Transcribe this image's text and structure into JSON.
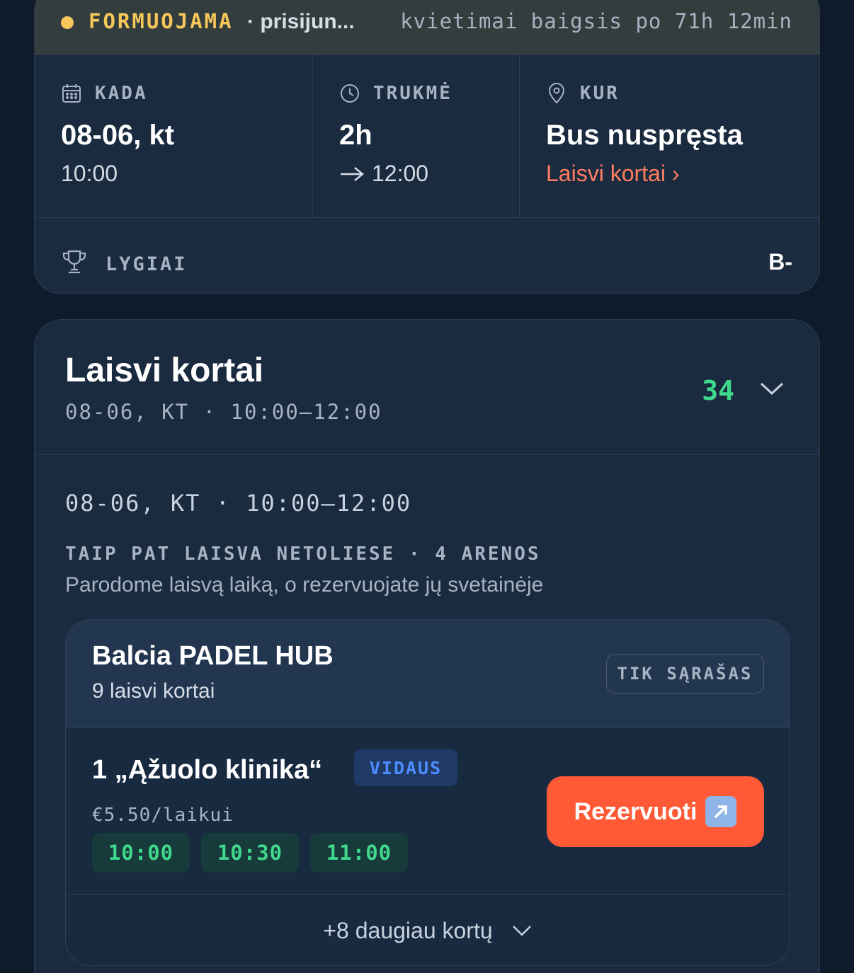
{
  "status": {
    "label": "FORMUOJAMA",
    "sub": "· prisijun...",
    "timer": "kvietimai baigsis po 71h 12min",
    "color": "#f5c75a"
  },
  "info": {
    "when": {
      "label": "KADA",
      "main": "08-06, kt",
      "sub": "10:00"
    },
    "duration": {
      "label": "TRUKMĖ",
      "main": "2h",
      "sub": "12:00"
    },
    "where": {
      "label": "KUR",
      "main": "Bus nuspręsta",
      "sub": "Laisvi kortai ›"
    }
  },
  "levels": {
    "label": "LYGIAI",
    "value": "B-"
  },
  "courts_panel": {
    "title": "Laisvi kortai",
    "subtitle": "08-06, KT · 10:00–12:00",
    "count": "34",
    "slot_heading": "08-06, KT · 10:00–12:00",
    "nearby_label": "TAIP PAT LAISVA NETOLIESE · 4 ARENOS",
    "nearby_desc": "Parodome laisvą laiką, o rezervuojate jų svetainėje"
  },
  "venue": {
    "name": "Balcia PADEL HUB",
    "count": "9 laisvi kortai",
    "badge": "TIK SĄRAŠAS",
    "court": {
      "name": "1 „Ąžuolo klinika“",
      "tag": "VIDAUS",
      "price": "€5.50/laikui",
      "slots": [
        "10:00",
        "10:30",
        "11:00"
      ],
      "reserve_label": "Rezervuoti"
    },
    "more": "+8 daugiau kortų"
  },
  "colors": {
    "accent_orange": "#ff5a35",
    "green": "#3fd98c",
    "blue_tag": "#4d8cff",
    "background": "#0f1b2b"
  },
  "icons": [
    "calendar-icon",
    "clock-icon",
    "map-pin-icon",
    "trophy-icon",
    "chevron-down-icon",
    "external-link-icon",
    "arrow-right-icon"
  ]
}
